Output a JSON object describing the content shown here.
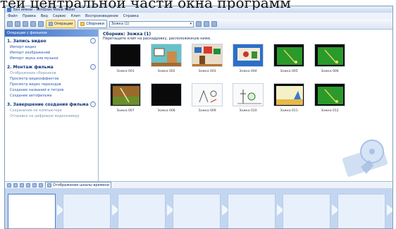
{
  "overlay_text": "тей центральной части окна программ",
  "window": {
    "title": "Без имени - Windows Movie Maker"
  },
  "menu": [
    "Файл",
    "Правка",
    "Вид",
    "Сервис",
    "Клип",
    "Воспроизведение",
    "Справка"
  ],
  "toolbar": {
    "operations_label": "Операции",
    "collections_label": "Сборники",
    "collection_combo": "Зожка (1)"
  },
  "tasks": {
    "header": "Операции с фильмом",
    "groups": [
      {
        "title": "1. Запись видео",
        "links": [
          "Импорт видео",
          "Импорт изображений",
          "Импорт звука или музыки"
        ]
      },
      {
        "title": "2. Монтаж фильма",
        "links": [
          "Отображение сборников",
          "Просмотр видеоэффектов",
          "Просмотр видео переходов",
          "Создание названий и титров",
          "Создание автофильма"
        ]
      },
      {
        "title": "3. Завершение создания фильма",
        "links": [
          "Сохранение на компьютере",
          "Отправка на цифровую видеокамеру"
        ]
      }
    ]
  },
  "collection": {
    "title": "Сборник: Зожка (1)",
    "hint": "Перетащите клип на раскадровку, расположенную ниже.",
    "clips": [
      {
        "label": "Зожка 001",
        "style": "black"
      },
      {
        "label": "Зожка 002",
        "style": "room"
      },
      {
        "label": "Зожка 003",
        "style": "wall"
      },
      {
        "label": "Зожка 004",
        "style": "blue"
      },
      {
        "label": "Зожка 005",
        "style": "field"
      },
      {
        "label": "Зожка 006",
        "style": "field"
      },
      {
        "label": "Зожка 007",
        "style": "brown"
      },
      {
        "label": "Зожка 008",
        "style": "black"
      },
      {
        "label": "Зожка 009",
        "style": "sketch"
      },
      {
        "label": "Зожка 010",
        "style": "sketch2"
      },
      {
        "label": "Зожка 011",
        "style": "yellow"
      },
      {
        "label": "Зожка 012",
        "style": "field"
      }
    ]
  },
  "storyboard": {
    "show_timeline_label": "Отображение шкалы времени",
    "slot_count": 8
  },
  "colors": {
    "frame_bg": "#dbe6f4",
    "task_header": "#3c6fc4",
    "link": "#2a59b0",
    "storyboard_bg": "#c3d6f0"
  }
}
